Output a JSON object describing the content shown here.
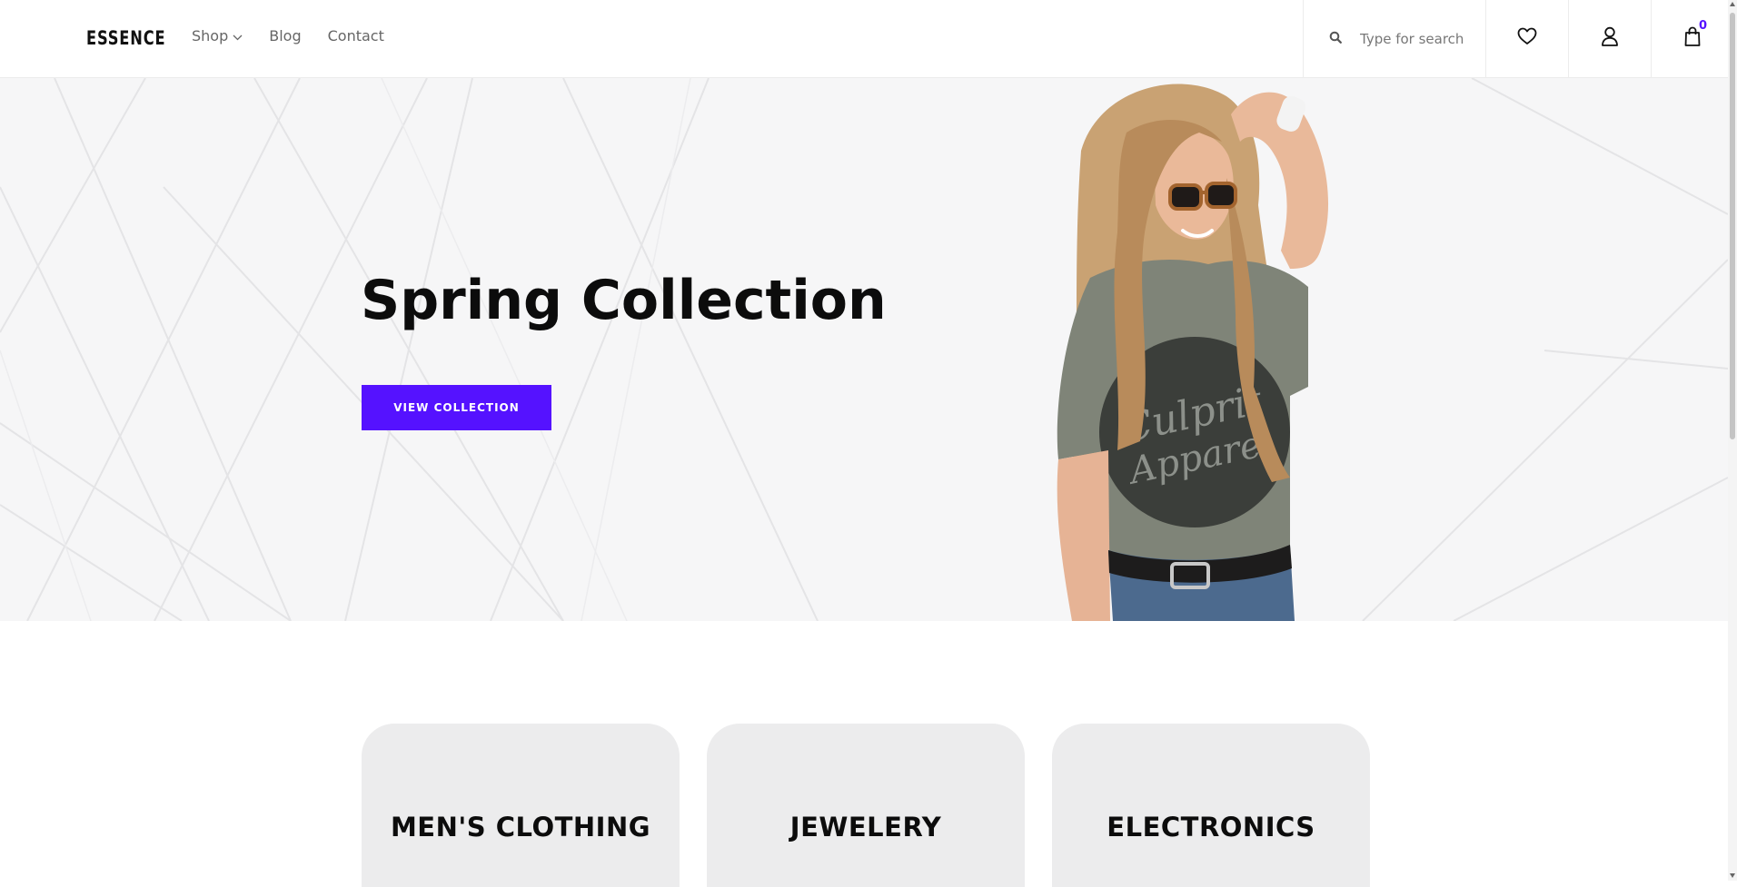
{
  "header": {
    "logo": "ESSENCE",
    "nav": [
      {
        "label": "Shop",
        "has_dropdown": true
      },
      {
        "label": "Blog"
      },
      {
        "label": "Contact"
      }
    ],
    "search": {
      "placeholder": "Type for search",
      "value": ""
    },
    "cart_count": "0"
  },
  "icons": {
    "search": "search-icon",
    "wishlist": "heart-icon",
    "account": "user-icon",
    "cart": "shopping-bag-icon",
    "dropdown": "chevron-down-icon"
  },
  "hero": {
    "title": "Spring Collection",
    "button_label": "VIEW COLLECTION"
  },
  "categories": [
    {
      "label": "MEN'S CLOTHING"
    },
    {
      "label": "JEWELERY"
    },
    {
      "label": "ELECTRONICS"
    }
  ],
  "colors": {
    "accent": "#5512ff",
    "text_dark": "#0c0c0c",
    "card_bg": "#ececed",
    "hero_bg": "#f6f6f7"
  }
}
